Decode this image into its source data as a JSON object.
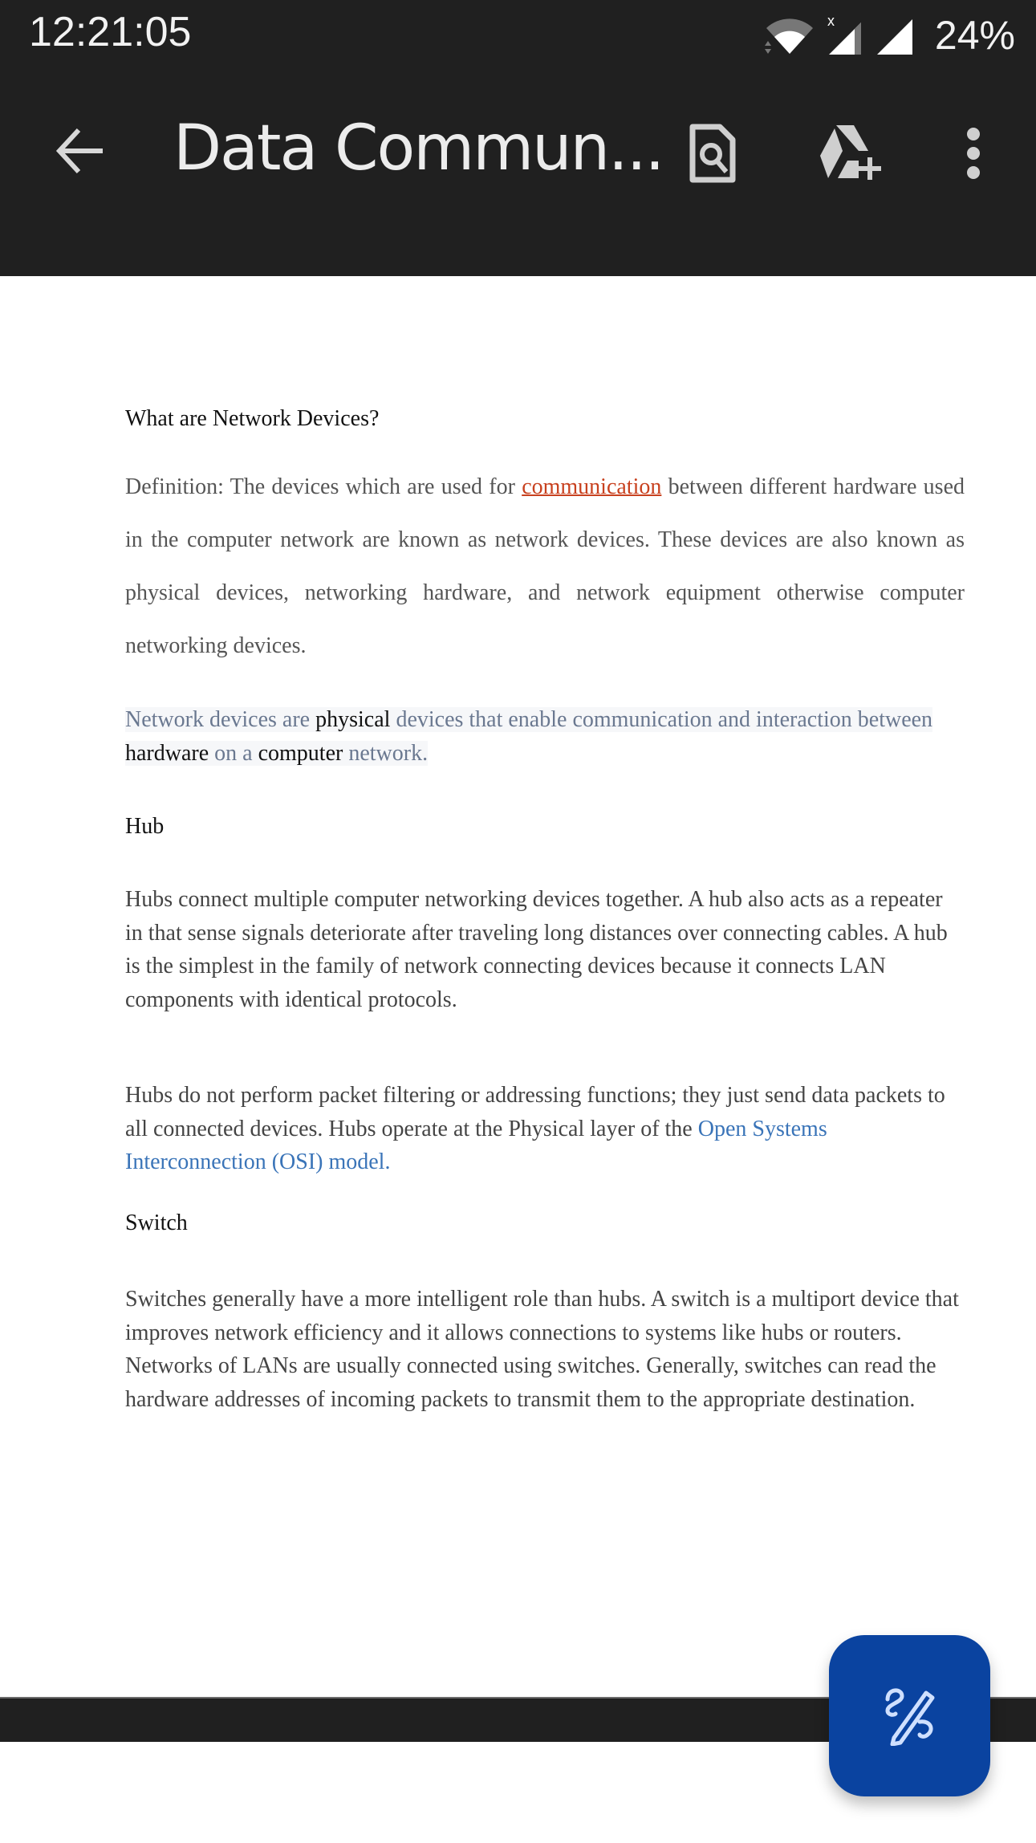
{
  "status_bar": {
    "time": "12:21:05",
    "battery": "24%",
    "icons": [
      "wifi-icon",
      "signal-no-data-icon",
      "signal-icon"
    ]
  },
  "app_bar": {
    "title": "Data Commun...",
    "back_icon": "arrow-left-icon",
    "actions": [
      {
        "name": "find-in-document",
        "icon": "doc-search-icon"
      },
      {
        "name": "save-to-drive",
        "icon": "drive-add-icon"
      },
      {
        "name": "more-options",
        "icon": "more-vert-icon"
      }
    ]
  },
  "document": {
    "section1": {
      "heading": "What are Network Devices?",
      "definition_before": "Definition: The devices which are used for ",
      "definition_link": "communication",
      "definition_after": " between different hardware used in the computer network are known as network devices. These devices are also known as physical devices, networking hardware, and network equipment otherwise computer networking devices."
    },
    "highlight": {
      "p1": "Network devices are ",
      "b1": "physical",
      "p2": " devices that enable communication and interaction between ",
      "b2": "hardware",
      "p3": " on a ",
      "b3": "computer",
      "p4": " network."
    },
    "hub": {
      "heading": "Hub",
      "para1": "Hubs connect multiple computer networking devices together. A hub also acts as a repeater in that sense signals deteriorate after traveling long distances over connecting cables. A hub is the simplest in the family of network connecting devices because it connects LAN components with identical protocols.",
      "para2_before": "Hubs do not perform packet filtering or addressing functions; they just send data packets to all connected devices. Hubs operate at the Physical layer of the ",
      "para2_link": "Open Systems Interconnection (OSI) model."
    },
    "switch": {
      "heading": "Switch",
      "para1": "Switches generally have a more intelligent role than hubs. A switch is a multiport device that improves network efficiency and it allows connections to systems like hubs or routers. Networks of LANs are usually connected using switches. Generally, switches can read the hardware addresses of incoming packets to transmit them to the appropriate destination."
    }
  },
  "fab": {
    "icon": "draw-annotate-icon",
    "color": "#0a43a0"
  },
  "colors": {
    "bar_background": "#202020",
    "link_red": "#c8411f",
    "link_blue": "#3a74b8"
  }
}
